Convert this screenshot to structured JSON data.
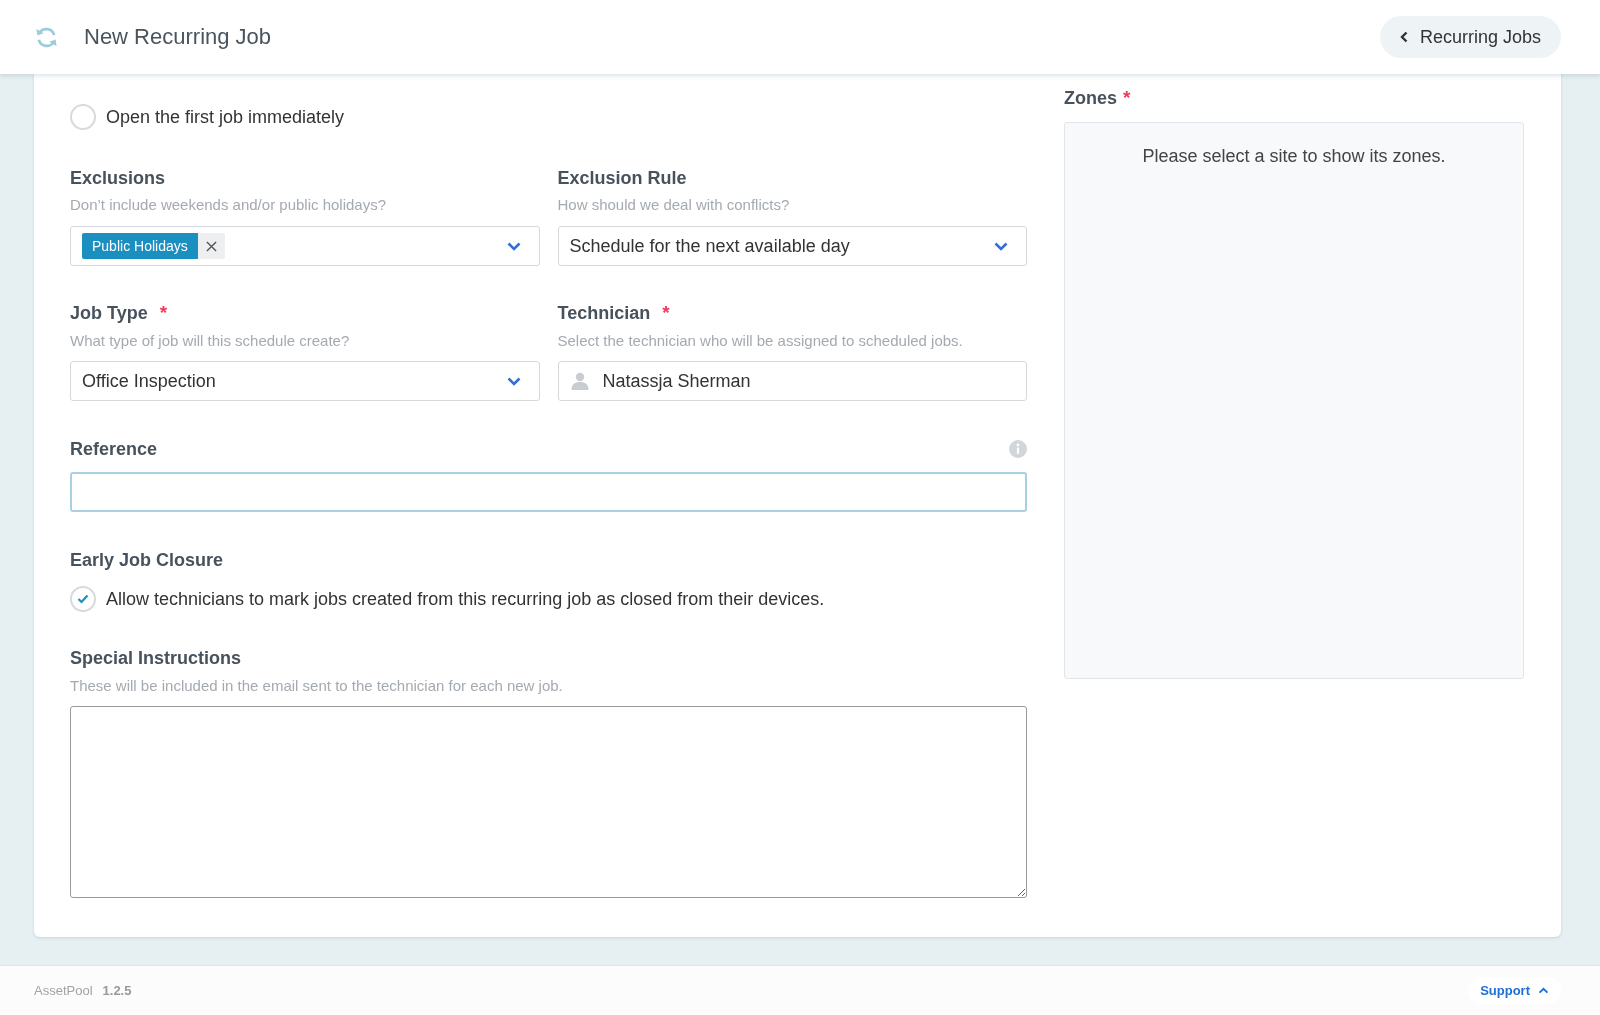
{
  "header": {
    "title": "New Recurring Job",
    "back_button": "Recurring Jobs"
  },
  "open_immediately": {
    "label": "Open the first job immediately",
    "checked": false
  },
  "exclusions": {
    "label": "Exclusions",
    "hint": "Don’t include weekends and/or public holidays?",
    "tags": [
      {
        "label": "Public Holidays"
      }
    ]
  },
  "exclusion_rule": {
    "label": "Exclusion Rule",
    "hint": "How should we deal with conflicts?",
    "value": "Schedule for the next available day"
  },
  "job_type": {
    "label": "Job Type",
    "required_mark": "*",
    "hint": "What type of job will this schedule create?",
    "value": "Office Inspection"
  },
  "technician": {
    "label": "Technician",
    "required_mark": "*",
    "hint": "Select the technician who will be assigned to scheduled jobs.",
    "value": "Natassja Sherman"
  },
  "reference": {
    "label": "Reference",
    "focused": true
  },
  "early_job_closure": {
    "label": "Early Job Closure",
    "option": {
      "label": "Allow technicians to mark jobs created from this recurring job as closed from their devices.",
      "checked": true
    }
  },
  "special_instructions": {
    "label": "Special Instructions",
    "hint": "These will be included in the email sent to the technician for each new job."
  },
  "zones": {
    "label": "Zones",
    "required_mark": "*",
    "empty_message": "Please select a site to show its zones."
  },
  "footer": {
    "app_name": "AssetPool",
    "version": "1.2.5",
    "support": "Support"
  }
}
